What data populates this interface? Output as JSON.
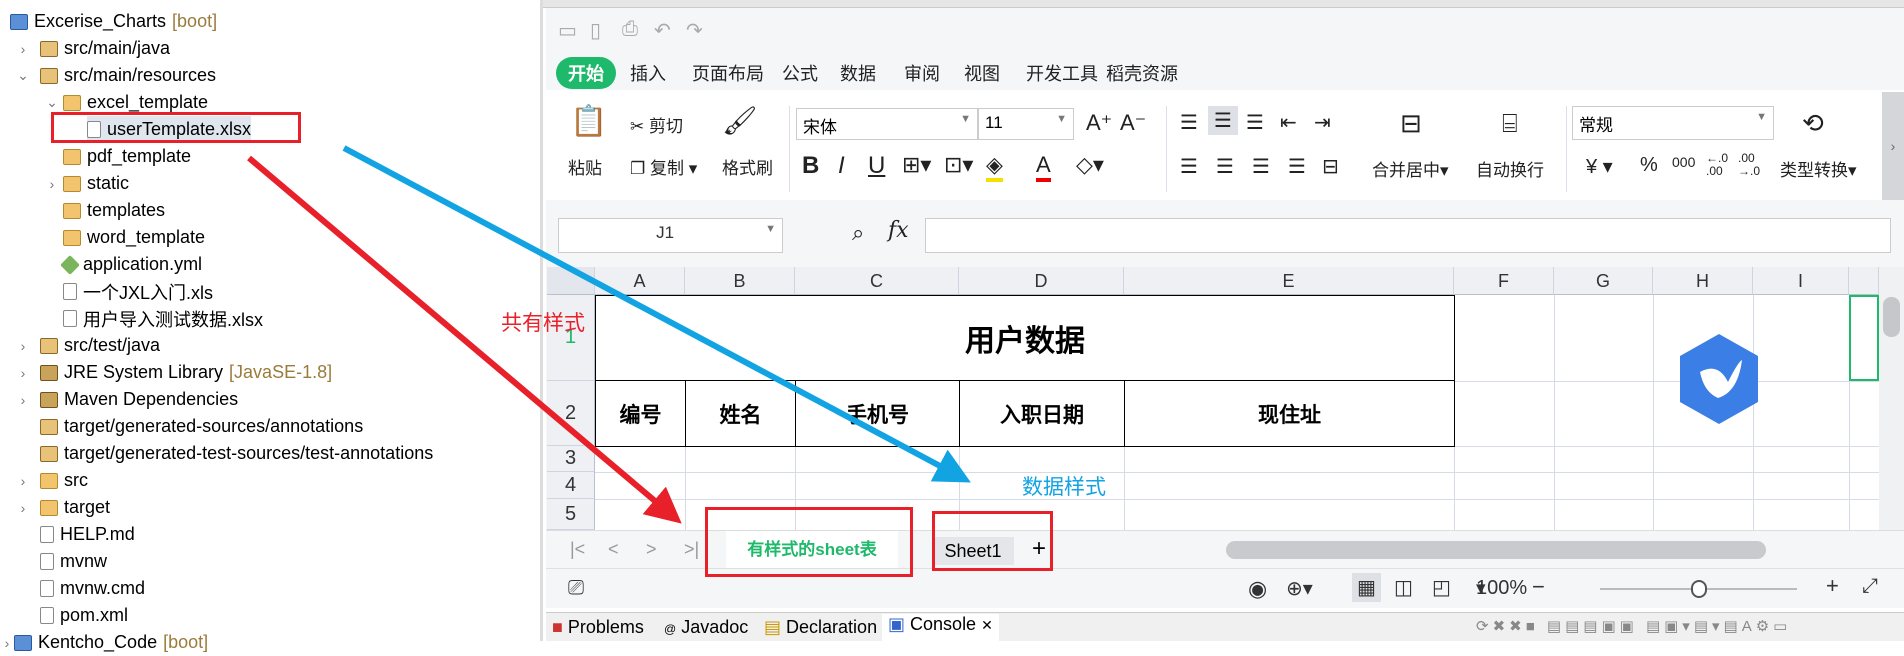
{
  "explorer": {
    "items": [
      {
        "label": "Excerise_Charts",
        "deco": "[boot]",
        "level": 0,
        "chevron": "",
        "icon": "proj"
      },
      {
        "label": "src/main/java",
        "level": 1,
        "chevron": ">",
        "icon": "pkg"
      },
      {
        "label": "src/main/resources",
        "level": 1,
        "chevron": "v",
        "icon": "pkg"
      },
      {
        "label": "excel_template",
        "level": 2,
        "chevron": "v",
        "icon": "folder"
      },
      {
        "label": "userTemplate.xlsx",
        "level": 3,
        "chevron": "",
        "icon": "file",
        "selected": true
      },
      {
        "label": "pdf_template",
        "level": 2,
        "chevron": "",
        "icon": "folder"
      },
      {
        "label": "static",
        "level": 2,
        "chevron": ">",
        "icon": "folder"
      },
      {
        "label": "templates",
        "level": 2,
        "chevron": "",
        "icon": "folder"
      },
      {
        "label": "word_template",
        "level": 2,
        "chevron": "",
        "icon": "folder"
      },
      {
        "label": "application.yml",
        "level": 2,
        "chevron": "",
        "icon": "yml"
      },
      {
        "label": "一个JXL入门.xls",
        "level": 2,
        "chevron": "",
        "icon": "file"
      },
      {
        "label": "用户导入测试数据.xlsx",
        "level": 2,
        "chevron": "",
        "icon": "file"
      },
      {
        "label": "src/test/java",
        "level": 1,
        "chevron": ">",
        "icon": "pkg"
      },
      {
        "label": "JRE System Library",
        "deco": "[JavaSE-1.8]",
        "level": 1,
        "chevron": ">",
        "icon": "lib"
      },
      {
        "label": "Maven Dependencies",
        "level": 1,
        "chevron": ">",
        "icon": "lib"
      },
      {
        "label": "target/generated-sources/annotations",
        "level": 1,
        "chevron": "",
        "icon": "pkg"
      },
      {
        "label": "target/generated-test-sources/test-annotations",
        "level": 1,
        "chevron": "",
        "icon": "pkg"
      },
      {
        "label": "src",
        "level": 1,
        "chevron": ">",
        "icon": "folder"
      },
      {
        "label": "target",
        "level": 1,
        "chevron": ">",
        "icon": "folder"
      },
      {
        "label": "HELP.md",
        "level": 1,
        "chevron": "",
        "icon": "file"
      },
      {
        "label": "mvnw",
        "level": 1,
        "chevron": "",
        "icon": "file"
      },
      {
        "label": "mvnw.cmd",
        "level": 1,
        "chevron": "",
        "icon": "file"
      },
      {
        "label": "pom.xml",
        "level": 1,
        "chevron": "",
        "icon": "file"
      },
      {
        "label": "Kentcho_Code",
        "deco": "[boot]",
        "level": 0,
        "chevron": ">",
        "icon": "proj"
      }
    ]
  },
  "ribbon": {
    "tabs": [
      "开始",
      "插入",
      "页面布局",
      "公式",
      "数据",
      "审阅",
      "视图",
      "开发工具",
      "稻壳资源"
    ],
    "paste": "粘贴",
    "cut": "剪切",
    "copy": "复制",
    "format_painter": "格式刷",
    "font": "宋体",
    "size": "11",
    "merge": "合并居中",
    "wrap": "自动换行",
    "number_format": "常规",
    "convert": "类型转换",
    "currency": "¥",
    "percent": "%",
    "thousands": "000",
    "inc_dec": "←.0 .00",
    "dec_dec": ".00 →.0"
  },
  "formula": {
    "name_box": "J1",
    "fx": "fx",
    "value": ""
  },
  "sheet": {
    "columns": [
      "A",
      "B",
      "C",
      "D",
      "E",
      "F",
      "G",
      "H",
      "I"
    ],
    "rows": [
      "1",
      "2",
      "3",
      "4",
      "5"
    ],
    "title": "用户数据",
    "headers": [
      "编号",
      "姓名",
      "手机号",
      "入职日期",
      "现住址"
    ]
  },
  "sheet_tabs": [
    "有样式的sheet表",
    "Sheet1"
  ],
  "annotations": {
    "shared_style": "共有样式",
    "data_style": "数据样式",
    "arrow_colors": {
      "red": "#e8202a",
      "blue": "#12a3e3"
    }
  },
  "status": {
    "zoom": "100%",
    "zoom_level": 0.5
  },
  "bottom_tabs": [
    "Problems",
    "Javadoc",
    "Declaration",
    "Console"
  ],
  "colors": {
    "accent": "#1fb96b",
    "annotation_red": "#e8202a",
    "annotation_blue": "#12a3e3"
  }
}
